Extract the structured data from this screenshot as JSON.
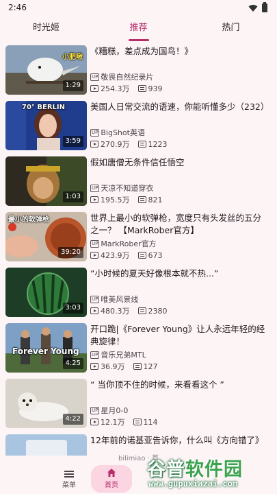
{
  "status_bar": {
    "time": "2:46"
  },
  "tabs": [
    {
      "label": "时光姬",
      "active": false
    },
    {
      "label": "推荐",
      "active": true
    },
    {
      "label": "热门",
      "active": false
    }
  ],
  "accent_color": "#b72d6a",
  "videos": [
    {
      "title": "《糟糕，差点成为国鸟！》",
      "thumb_text": "小肥啾",
      "duration": "1:29",
      "uploader": "敬畏自然纪录片",
      "views": "254.3万",
      "danmaku": "939"
    },
    {
      "title": "美国人日常交流的语速，你能听懂多少（232）",
      "thumb_text": "70° BERLIN",
      "duration": "3:59",
      "uploader": "BigShot英语",
      "views": "270.9万",
      "danmaku": "1223"
    },
    {
      "title": "假如唐僧无条件信任悟空",
      "thumb_text": "",
      "duration": "1:03",
      "uploader": "天凉不知道穿衣",
      "views": "195.5万",
      "danmaku": "821"
    },
    {
      "title": "世界上最小的软弹枪，宽度只有头发丝的五分之一？ 【MarkRober官方】",
      "thumb_text": "最小的软弹枪",
      "duration": "39:20",
      "uploader": "MarkRober官方",
      "views": "423.9万",
      "danmaku": "673"
    },
    {
      "title": "“小时候的夏天好像根本就不热...”",
      "thumb_text": "",
      "duration": "3:03",
      "uploader": "唯美风景线",
      "views": "480.3万",
      "danmaku": "2380"
    },
    {
      "title": "开口跪|《Forever Young》让人永远年轻的经典旋律！",
      "thumb_text": "Forever Young",
      "duration": "4:25",
      "uploader": "音乐兄弟MTL",
      "views": "36.9万",
      "danmaku": "127"
    },
    {
      "title": "“ 当你顶不住的时候，来看看这个 ”",
      "thumb_text": "",
      "duration": "4:22",
      "uploader": "星月0-0",
      "views": "12.1万",
      "danmaku": "114"
    },
    {
      "title": "12年前的诺基亚告诉你，什么叫《方向错了》",
      "thumb_text": "",
      "duration": "",
      "uploader": "",
      "views": "",
      "danmaku": ""
    }
  ],
  "up_badge": "UP",
  "footer_text": "bilimiao · 首",
  "bottom_nav": {
    "menu_label": "菜单",
    "home_label": "首页"
  },
  "watermark": {
    "part1": "谷普",
    "part2": "软件园",
    "url": "www.gupuxiazai.com"
  }
}
